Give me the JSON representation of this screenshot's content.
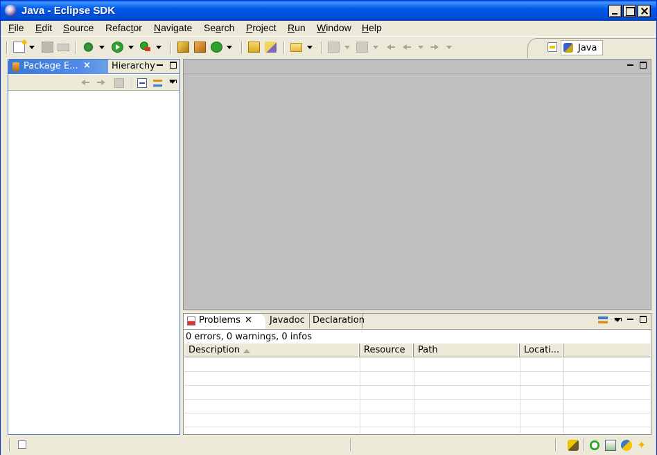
{
  "window": {
    "title": "Java - Eclipse SDK",
    "controls": [
      "minimize-button",
      "maximize-button",
      "close-button"
    ]
  },
  "menubar": {
    "items": [
      {
        "pre": "",
        "mn": "F",
        "post": "ile"
      },
      {
        "pre": "",
        "mn": "E",
        "post": "dit"
      },
      {
        "pre": "",
        "mn": "S",
        "post": "ource"
      },
      {
        "pre": "Refac",
        "mn": "t",
        "post": "or"
      },
      {
        "pre": "",
        "mn": "N",
        "post": "avigate"
      },
      {
        "pre": "Se",
        "mn": "a",
        "post": "rch"
      },
      {
        "pre": "",
        "mn": "P",
        "post": "roject"
      },
      {
        "pre": "",
        "mn": "R",
        "post": "un"
      },
      {
        "pre": "",
        "mn": "W",
        "post": "indow"
      },
      {
        "pre": "",
        "mn": "H",
        "post": "elp"
      }
    ]
  },
  "toolbar": {
    "icons": [
      "new-icon",
      "save-icon",
      "print-icon",
      "debug-icon",
      "run-icon",
      "external-tools-icon",
      "new-package-icon",
      "new-class-icon",
      "new-java-class-icon",
      "open-type-icon",
      "search-icon",
      "open-folder-icon",
      "next-annotation-icon",
      "prev-annotation-icon",
      "back-icon",
      "forward-icon"
    ]
  },
  "perspective": {
    "label": "Java",
    "icons": [
      "open-perspective-icon",
      "java-perspective-icon"
    ]
  },
  "left_view": {
    "tabs": [
      {
        "label": "Package E...",
        "active": true
      },
      {
        "label": "Hierarchy",
        "active": false
      }
    ],
    "close_glyph": "×"
  },
  "editor_area": {
    "empty": true
  },
  "problems_view": {
    "tabs": [
      {
        "label": "Problems",
        "active": true
      },
      {
        "label": "Javadoc",
        "active": false
      },
      {
        "label": "Declaration",
        "active": false
      }
    ],
    "close_glyph": "✕",
    "summary": "0 errors, 0 warnings, 0 infos",
    "columns": [
      "Description",
      "Resource",
      "Path",
      "Locati..."
    ],
    "sort_column": "Description",
    "rows": []
  },
  "statusbar": {
    "icons": [
      "fast-view-icon",
      "progress-icon",
      "search-status-icon",
      "update-icon",
      "tip-icon"
    ]
  },
  "colors": {
    "titlebar": "#0058e6",
    "active_tab": "#3b79d7",
    "chrome": "#ece9d8",
    "editor_bg": "#c0c0c0"
  }
}
